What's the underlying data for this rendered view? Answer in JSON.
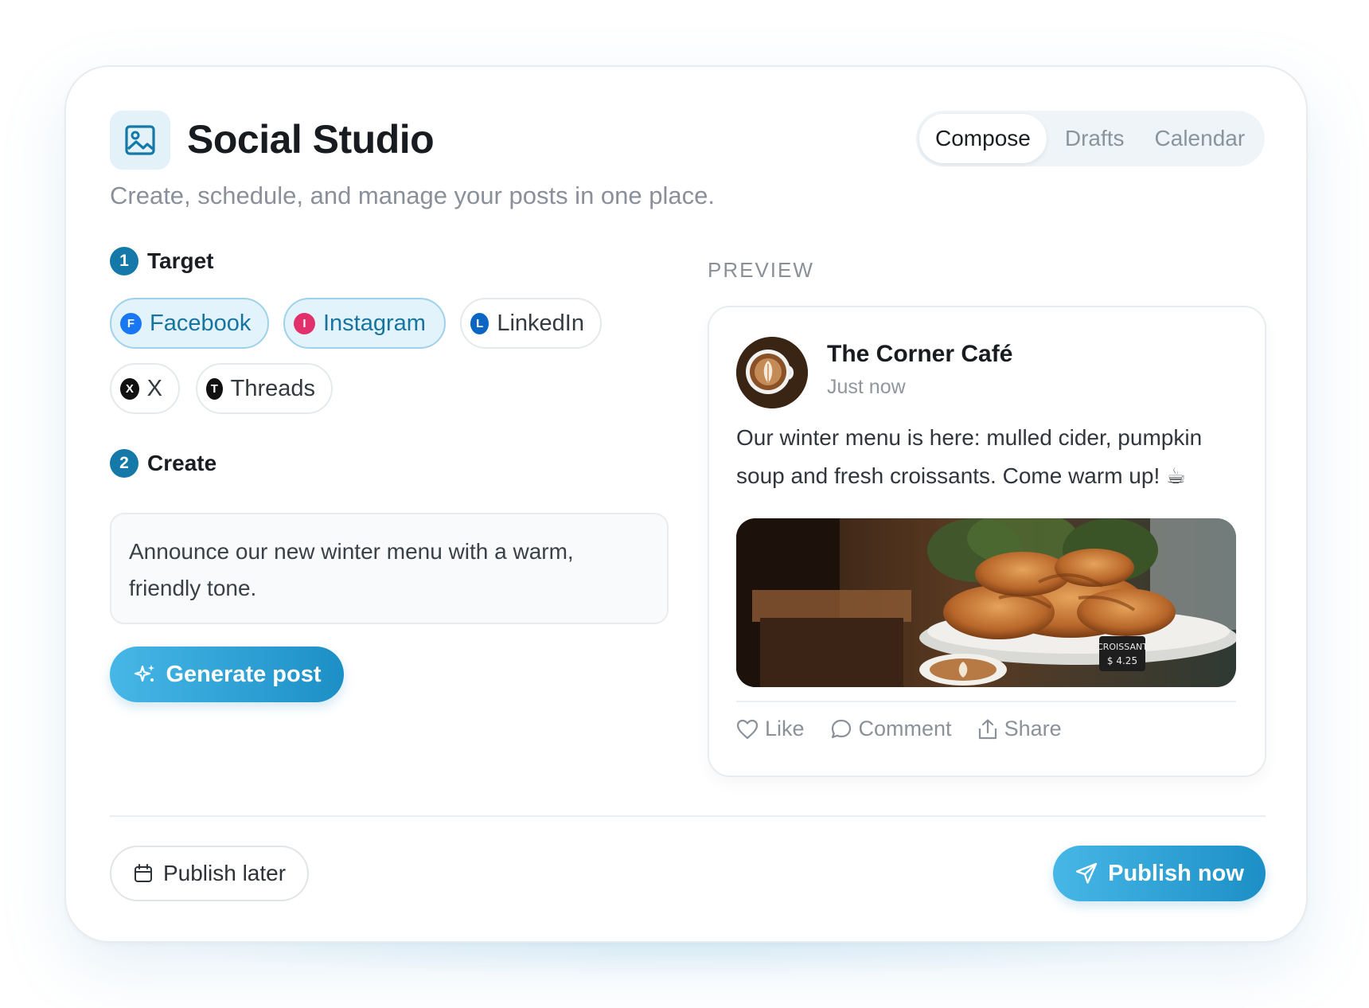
{
  "app": {
    "title": "Social Studio",
    "subtitle": "Create, schedule, and manage your posts in one place.",
    "icon": "image-icon"
  },
  "tabs": [
    {
      "label": "Compose",
      "active": true
    },
    {
      "label": "Drafts",
      "active": false
    },
    {
      "label": "Calendar",
      "active": false
    }
  ],
  "target": {
    "step": "1",
    "label": "Target",
    "platforms": [
      {
        "letter": "F",
        "label": "Facebook",
        "selected": true,
        "color": "#1877f2"
      },
      {
        "letter": "I",
        "label": "Instagram",
        "selected": true,
        "color": "#e1306c"
      },
      {
        "letter": "L",
        "label": "LinkedIn",
        "selected": false,
        "color": "#0a66c2"
      },
      {
        "letter": "X",
        "label": "X",
        "selected": false,
        "color": "#000000"
      },
      {
        "letter": "T",
        "label": "Threads",
        "selected": false,
        "color": "#000000"
      }
    ]
  },
  "create": {
    "step": "2",
    "label": "Create",
    "prompt": "Announce our new winter menu with a warm, friendly tone.",
    "generate_label": "Generate post"
  },
  "preview": {
    "label": "PREVIEW",
    "account_name": "The Corner Café",
    "time": "Just now",
    "text": "Our winter menu is here: mulled cider, pumpkin soup and fresh croissants. Come warm up! ☕",
    "image_sign_line1": "CROISSANT",
    "image_sign_line2": "$ 4.25",
    "actions": {
      "like": "Like",
      "comment": "Comment",
      "share": "Share"
    }
  },
  "footer": {
    "publish_later": "Publish later",
    "publish_now": "Publish now"
  },
  "colors": {
    "accent": "#1c8fc6",
    "accent_light": "#46b7e6",
    "step_badge": "#1479a8"
  }
}
